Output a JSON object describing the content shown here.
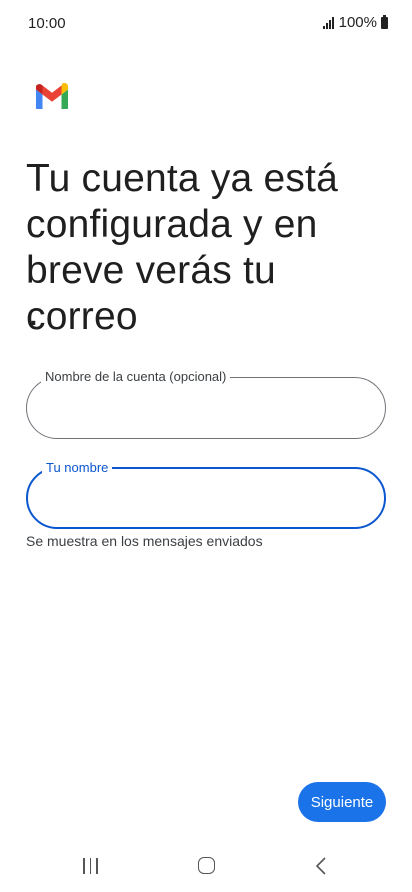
{
  "status_bar": {
    "time": "10:00",
    "battery": "100%"
  },
  "app": {
    "logo_icon": "gmail-logo-icon"
  },
  "page": {
    "title": "Tu cuenta ya está configurada y en breve verás tu correo",
    "title_trailing": "."
  },
  "form": {
    "account_name": {
      "label": "Nombre de la cuenta (opcional)",
      "value": "",
      "state": "default"
    },
    "your_name": {
      "label": "Tu nombre",
      "value": "",
      "state": "focused",
      "helper": "Se muestra en los mensajes enviados"
    }
  },
  "actions": {
    "next_label": "Siguiente"
  },
  "nav_bar": {
    "icons": [
      "recents-icon",
      "home-icon",
      "back-icon"
    ]
  },
  "colors": {
    "accent": "#0b57d0",
    "button": "#1a73e8",
    "text": "#1f1f1f",
    "outline": "#6f7378"
  }
}
